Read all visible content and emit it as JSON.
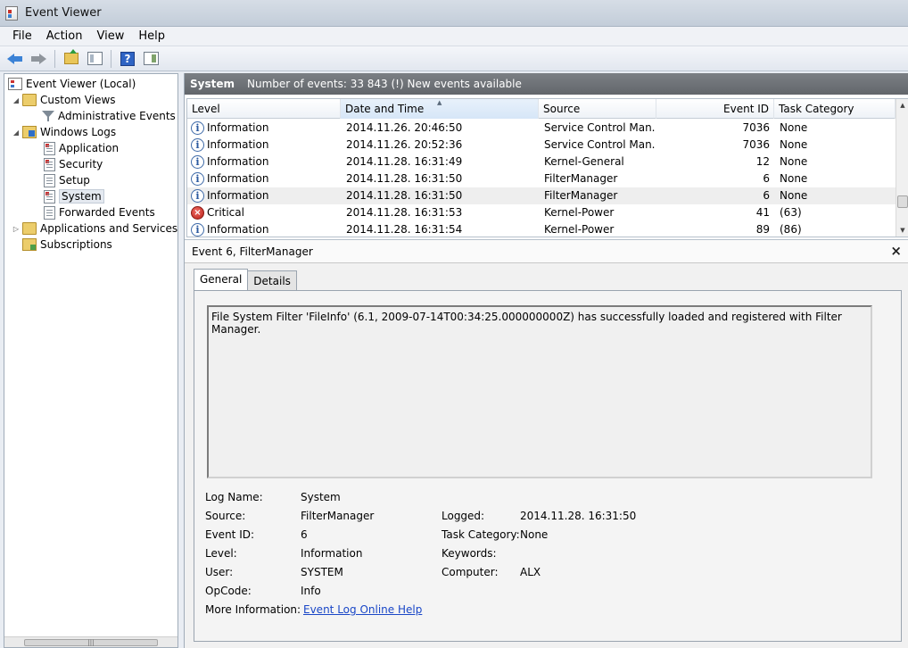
{
  "window": {
    "title": "Event Viewer"
  },
  "menu": [
    "File",
    "Action",
    "View",
    "Help"
  ],
  "toolbar": {
    "icons": [
      "back-arrow-icon",
      "forward-arrow-icon",
      "folder-up-icon",
      "show-hide-tree-icon",
      "help-icon",
      "show-hide-action-pane-icon"
    ],
    "help_glyph": "?"
  },
  "tree": {
    "root": "Event Viewer (Local)",
    "custom_views": "Custom Views",
    "administrative_events": "Administrative Events",
    "windows_logs": "Windows Logs",
    "application": "Application",
    "security": "Security",
    "setup": "Setup",
    "system": "System",
    "forwarded_events": "Forwarded Events",
    "apps_services": "Applications and Services Lo",
    "subscriptions": "Subscriptions"
  },
  "log": {
    "name": "System",
    "summary": "Number of events: 33 843 (!) New events available"
  },
  "columns": {
    "level": "Level",
    "date_time": "Date and Time",
    "source": "Source",
    "event_id": "Event ID",
    "task_category": "Task Category"
  },
  "rows": [
    {
      "level": "Information",
      "date": "2014.11.26. 20:46:50",
      "source": "Service Control Man...",
      "id": "7036",
      "task": "None",
      "icon": "info-icon"
    },
    {
      "level": "Information",
      "date": "2014.11.26. 20:52:36",
      "source": "Service Control Man...",
      "id": "7036",
      "task": "None",
      "icon": "info-icon"
    },
    {
      "level": "Information",
      "date": "2014.11.28. 16:31:49",
      "source": "Kernel-General",
      "id": "12",
      "task": "None",
      "icon": "info-icon"
    },
    {
      "level": "Information",
      "date": "2014.11.28. 16:31:50",
      "source": "FilterManager",
      "id": "6",
      "task": "None",
      "icon": "info-icon"
    },
    {
      "level": "Information",
      "date": "2014.11.28. 16:31:50",
      "source": "FilterManager",
      "id": "6",
      "task": "None",
      "icon": "info-icon",
      "selected": true
    },
    {
      "level": "Critical",
      "date": "2014.11.28. 16:31:53",
      "source": "Kernel-Power",
      "id": "41",
      "task": "(63)",
      "icon": "critical-icon"
    },
    {
      "level": "Information",
      "date": "2014.11.28. 16:31:54",
      "source": "Kernel-Power",
      "id": "89",
      "task": "(86)",
      "icon": "info-icon"
    }
  ],
  "icon_glyphs": {
    "info": "i",
    "critical": "×",
    "close": "×",
    "scroll_up": "▲",
    "scroll_down": "▼",
    "collapse": "◢",
    "expand": "▷",
    "scroll_grip": "|||"
  },
  "detail": {
    "title": "Event 6, FilterManager",
    "tabs": {
      "general": "General",
      "details": "Details"
    },
    "message": "File System Filter 'FileInfo' (6.1, 2009-07-14T00:34:25.000000000Z) has successfully loaded and registered with Filter Manager.",
    "labels": {
      "log_name": "Log Name:",
      "source": "Source:",
      "event_id": "Event ID:",
      "level": "Level:",
      "user": "User:",
      "opcode": "OpCode:",
      "more_info": "More Information:",
      "logged": "Logged:",
      "task_category": "Task Category:",
      "keywords": "Keywords:",
      "computer": "Computer:"
    },
    "values": {
      "log_name": "System",
      "source": "FilterManager",
      "event_id": "6",
      "level": "Information",
      "user": "SYSTEM",
      "opcode": "Info",
      "more_info_link": "Event Log Online Help",
      "logged": "2014.11.28. 16:31:50",
      "task_category": "None",
      "keywords": "",
      "computer": "ALX"
    }
  }
}
